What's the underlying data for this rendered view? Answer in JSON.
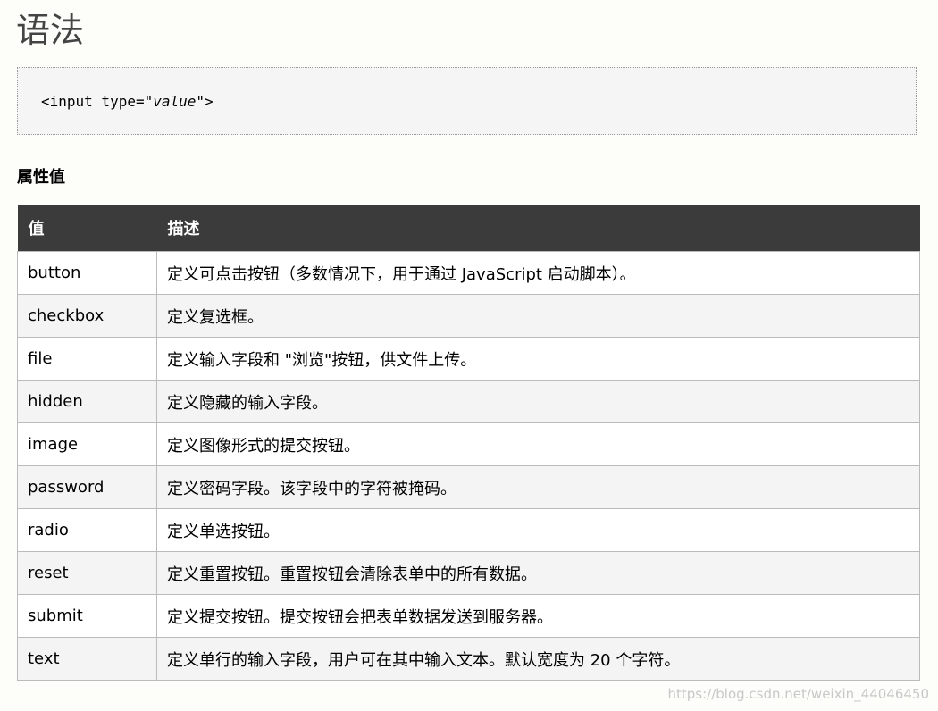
{
  "heading": "语法",
  "code": {
    "prefix": "<input type=\"",
    "arg": "value",
    "suffix": "\">"
  },
  "section_title": "属性值",
  "table": {
    "headers": [
      "值",
      "描述"
    ],
    "rows": [
      {
        "value": "button",
        "desc": "定义可点击按钮（多数情况下，用于通过 JavaScript 启动脚本）。"
      },
      {
        "value": "checkbox",
        "desc": "定义复选框。"
      },
      {
        "value": "file",
        "desc": "定义输入字段和 \"浏览\"按钮，供文件上传。"
      },
      {
        "value": "hidden",
        "desc": "定义隐藏的输入字段。"
      },
      {
        "value": "image",
        "desc": "定义图像形式的提交按钮。"
      },
      {
        "value": "password",
        "desc": "定义密码字段。该字段中的字符被掩码。"
      },
      {
        "value": "radio",
        "desc": "定义单选按钮。"
      },
      {
        "value": "reset",
        "desc": "定义重置按钮。重置按钮会清除表单中的所有数据。"
      },
      {
        "value": "submit",
        "desc": "定义提交按钮。提交按钮会把表单数据发送到服务器。"
      },
      {
        "value": "text",
        "desc": "定义单行的输入字段，用户可在其中输入文本。默认宽度为 20 个字符。"
      }
    ]
  },
  "watermark": "https://blog.csdn.net/weixin_44046450"
}
